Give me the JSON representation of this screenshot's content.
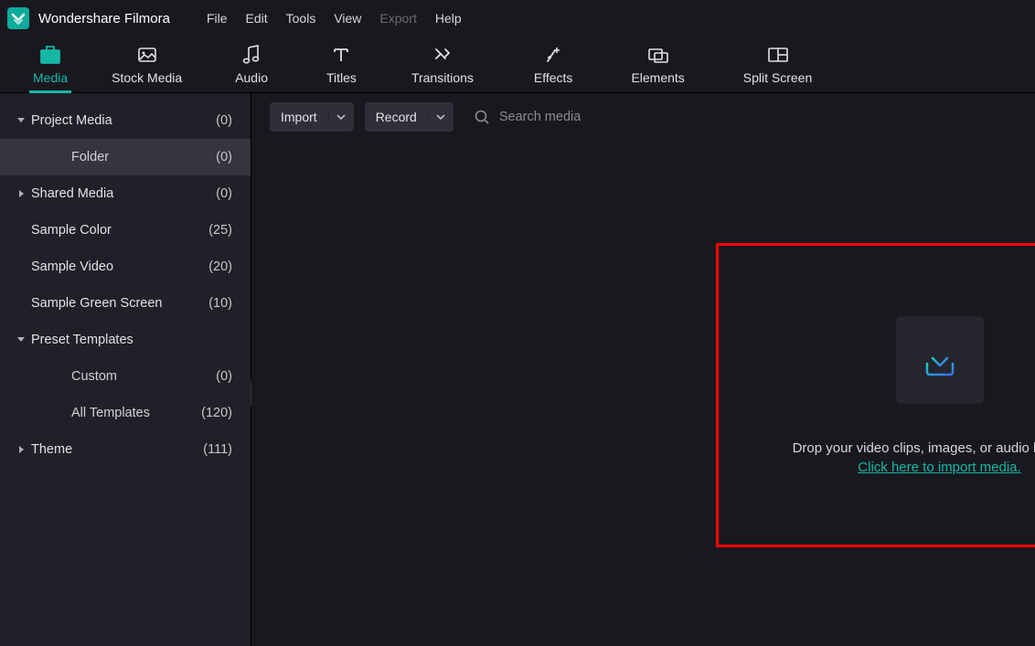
{
  "app_title": "Wondershare Filmora",
  "menu": [
    "File",
    "Edit",
    "Tools",
    "View",
    "Export",
    "Help"
  ],
  "menu_disabled_index": 4,
  "tool_tabs": [
    {
      "label": "Media",
      "active": true,
      "icon": "media"
    },
    {
      "label": "Stock Media",
      "icon": "stock"
    },
    {
      "label": "Audio",
      "icon": "audio"
    },
    {
      "label": "Titles",
      "icon": "titles"
    },
    {
      "label": "Transitions",
      "icon": "transitions"
    },
    {
      "label": "Effects",
      "icon": "effects"
    },
    {
      "label": "Elements",
      "icon": "elements"
    },
    {
      "label": "Split Screen",
      "icon": "split"
    }
  ],
  "sidebar": [
    {
      "label": "Project Media",
      "count": "(0)",
      "depth": 0,
      "arrow": "down"
    },
    {
      "label": "Folder",
      "count": "(0)",
      "depth": 1,
      "selected": true
    },
    {
      "label": "Shared Media",
      "count": "(0)",
      "depth": 0,
      "arrow": "right"
    },
    {
      "label": "Sample Color",
      "count": "(25)",
      "depth": 0
    },
    {
      "label": "Sample Video",
      "count": "(20)",
      "depth": 0
    },
    {
      "label": "Sample Green Screen",
      "count": "(10)",
      "depth": 0
    },
    {
      "label": "Preset Templates",
      "count": "",
      "depth": 0,
      "arrow": "down"
    },
    {
      "label": "Custom",
      "count": "(0)",
      "depth": 1
    },
    {
      "label": "All Templates",
      "count": "(120)",
      "depth": 1
    },
    {
      "label": "Theme",
      "count": "(111)",
      "depth": 0,
      "arrow": "right"
    }
  ],
  "buttons": {
    "import": "Import",
    "record": "Record"
  },
  "search_placeholder": "Search media",
  "drop_message": "Drop your video clips, images, or audio here! Or,",
  "import_link": "Click here to import media."
}
